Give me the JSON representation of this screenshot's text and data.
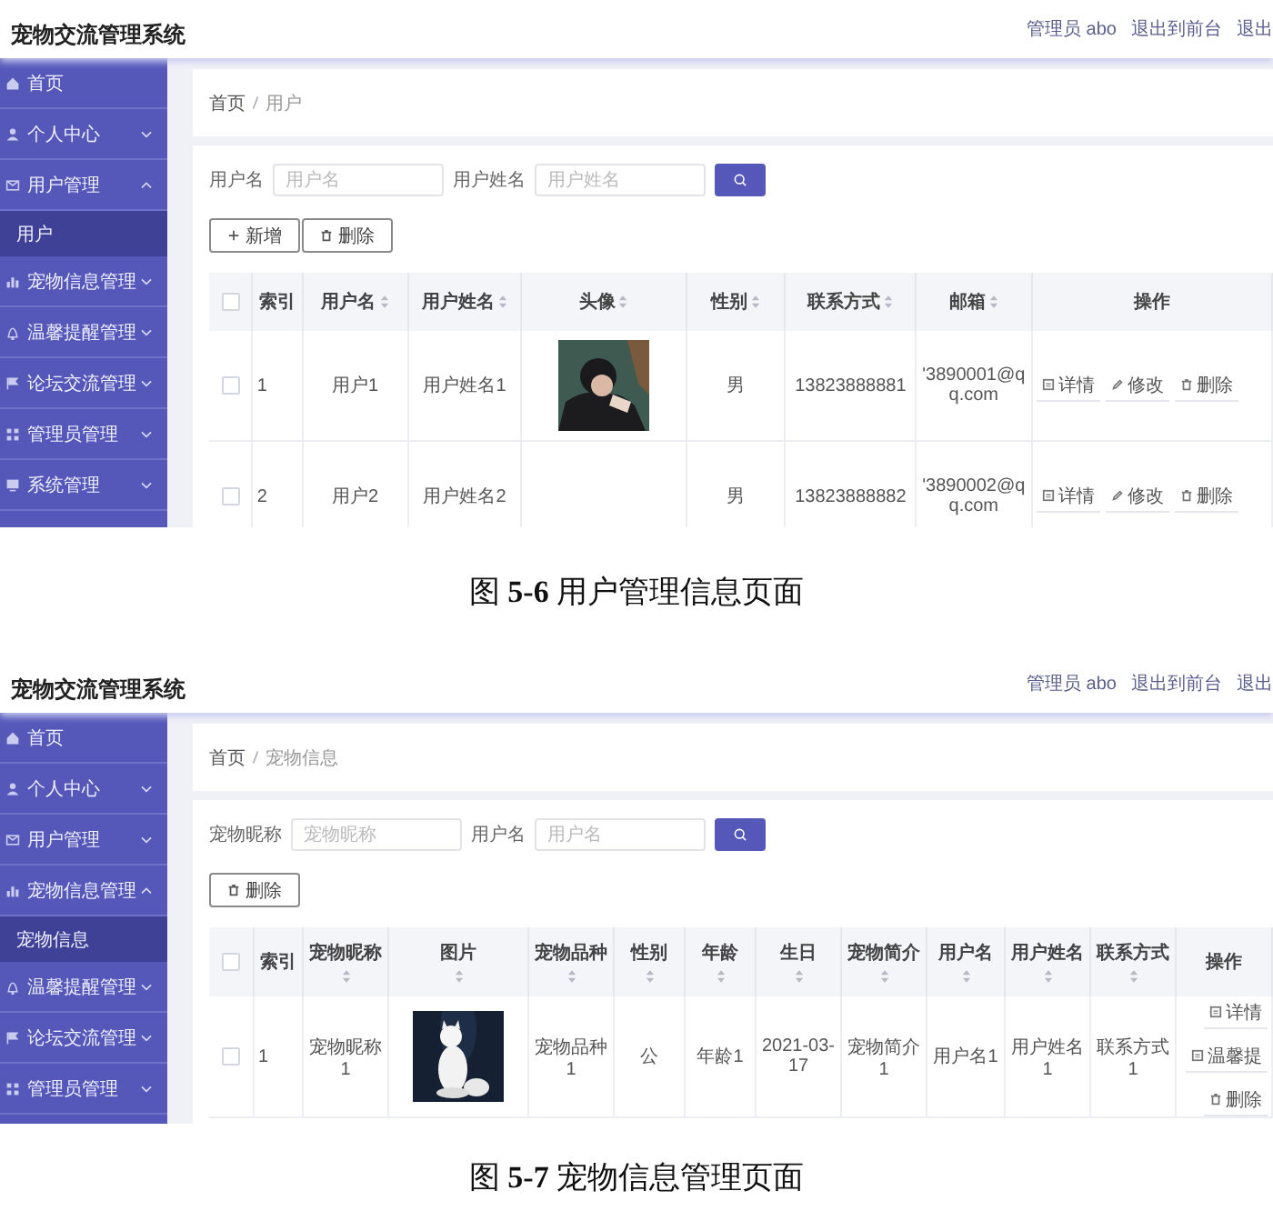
{
  "figures": [
    {
      "app_title": "宠物交流管理系统",
      "header_links": [
        "管理员 abo",
        "退出到前台",
        "退出"
      ],
      "sidebar": [
        {
          "kind": "link",
          "label": "首页"
        },
        {
          "kind": "menu",
          "label": "个人中心",
          "expanded": false
        },
        {
          "kind": "menu",
          "label": "用户管理",
          "expanded": true,
          "children": [
            {
              "label": "用户",
              "selected": true
            }
          ]
        },
        {
          "kind": "menu",
          "label": "宠物信息管理",
          "expanded": false
        },
        {
          "kind": "menu",
          "label": "温馨提醒管理",
          "expanded": false
        },
        {
          "kind": "menu",
          "label": "论坛交流管理",
          "expanded": false
        },
        {
          "kind": "menu",
          "label": "管理员管理",
          "expanded": false
        },
        {
          "kind": "menu",
          "label": "系统管理",
          "expanded": false
        }
      ],
      "breadcrumb": [
        "首页",
        "用户"
      ],
      "search_fields": [
        {
          "label": "用户名",
          "placeholder": "用户名"
        },
        {
          "label": "用户姓名",
          "placeholder": "用户姓名"
        }
      ],
      "toolbar": [
        {
          "kind": "add",
          "label": "新增"
        },
        {
          "kind": "delete",
          "label": "删除"
        }
      ],
      "table": {
        "all_checked": false,
        "columns": [
          {
            "label": "索引",
            "sortable": false
          },
          {
            "label": "用户名",
            "sortable": true
          },
          {
            "label": "用户姓名",
            "sortable": true
          },
          {
            "label": "头像",
            "sortable": true
          },
          {
            "label": "性别",
            "sortable": true
          },
          {
            "label": "联系方式",
            "sortable": true
          },
          {
            "label": "邮箱",
            "sortable": true
          },
          {
            "label": "操作",
            "sortable": false
          }
        ],
        "rows": [
          {
            "checked": false,
            "cells": [
              "1",
              "用户1",
              "用户姓名1",
              {
                "kind": "picture"
              },
              "男",
              "13823888881",
              "'3890001@qq.com"
            ],
            "actions": [
              {
                "kind": "detail",
                "label": "详情"
              },
              {
                "kind": "edit",
                "label": "修改"
              },
              {
                "kind": "delete",
                "label": "删除"
              }
            ]
          },
          {
            "checked": false,
            "cells": [
              "2",
              "用户2",
              "用户姓名2",
              {
                "kind": "blank"
              },
              "男",
              "13823888882",
              "'3890002@qq.com"
            ],
            "actions": [
              {
                "kind": "detail",
                "label": "详情"
              },
              {
                "kind": "edit",
                "label": "修改"
              },
              {
                "kind": "delete",
                "label": "删除"
              }
            ]
          }
        ]
      },
      "caption": "图 **5-6** 用户管理信息页面"
    },
    {
      "app_title": "宠物交流管理系统",
      "header_links": [
        "管理员 abo",
        "退出到前台",
        "退出"
      ],
      "sidebar": [
        {
          "kind": "link",
          "label": "首页"
        },
        {
          "kind": "menu",
          "label": "个人中心",
          "expanded": false
        },
        {
          "kind": "menu",
          "label": "用户管理",
          "expanded": false
        },
        {
          "kind": "menu",
          "label": "宠物信息管理",
          "expanded": true,
          "children": [
            {
              "label": "宠物信息",
              "selected": true
            }
          ]
        },
        {
          "kind": "menu",
          "label": "温馨提醒管理",
          "expanded": false
        },
        {
          "kind": "menu",
          "label": "论坛交流管理",
          "expanded": false
        },
        {
          "kind": "menu",
          "label": "管理员管理",
          "expanded": false
        }
      ],
      "breadcrumb": [
        "首页",
        "宠物信息"
      ],
      "search_fields": [
        {
          "label": "宠物昵称",
          "placeholder": "宠物昵称"
        },
        {
          "label": "用户名",
          "placeholder": "用户名"
        }
      ],
      "toolbar": [
        {
          "kind": "delete",
          "label": "删除"
        }
      ],
      "table": {
        "all_checked": false,
        "columns": [
          {
            "label": "索引",
            "sortable": false
          },
          {
            "label": "宠物昵称",
            "sortable": true
          },
          {
            "label": "图片",
            "sortable": true
          },
          {
            "label": "宠物品种",
            "sortable": true
          },
          {
            "label": "性别",
            "sortable": true
          },
          {
            "label": "年龄",
            "sortable": true
          },
          {
            "label": "生日",
            "sortable": true
          },
          {
            "label": "宠物简介",
            "sortable": true
          },
          {
            "label": "用户名",
            "sortable": true
          },
          {
            "label": "用户姓名",
            "sortable": true
          },
          {
            "label": "联系方式",
            "sortable": true
          },
          {
            "label": "操作",
            "sortable": false
          }
        ],
        "rows": [
          {
            "checked": false,
            "cells": [
              "1",
              "宠物昵称1",
              {
                "kind": "picture"
              },
              "宠物品种1",
              "公",
              "年龄1",
              "2021-03-17",
              "宠物简介1",
              "用户名1",
              "用户姓名1",
              "联系方式1"
            ],
            "actions": [
              {
                "kind": "detail",
                "label": "详情"
              },
              {
                "kind": "note",
                "label": "温馨提"
              },
              {
                "kind": "delete",
                "label": "删除"
              }
            ]
          }
        ]
      },
      "caption": "图 **5-7** 宠物信息管理页面"
    }
  ]
}
